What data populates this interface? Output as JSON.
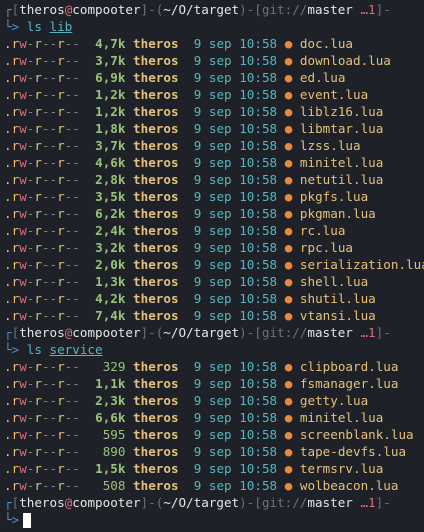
{
  "prompt": {
    "user": "theros",
    "at": "@",
    "host": "compooter",
    "path": "~/O/target",
    "git_prefix": "git://",
    "branch": "master",
    "status": "…1"
  },
  "commands": [
    {
      "cmd": "ls",
      "arg": "lib"
    },
    {
      "cmd": "ls",
      "arg": "service"
    }
  ],
  "listings": [
    {
      "entries": [
        {
          "perm": ".rw-r--r--",
          "size": "4,7k",
          "owner": "theros",
          "date": "9 sep 10:58",
          "icon": "lua-icon",
          "name": "doc.lua"
        },
        {
          "perm": ".rw-r--r--",
          "size": "3,7k",
          "owner": "theros",
          "date": "9 sep 10:58",
          "icon": "lua-icon",
          "name": "download.lua"
        },
        {
          "perm": ".rw-r--r--",
          "size": "6,9k",
          "owner": "theros",
          "date": "9 sep 10:58",
          "icon": "lua-icon",
          "name": "ed.lua"
        },
        {
          "perm": ".rw-r--r--",
          "size": "1,2k",
          "owner": "theros",
          "date": "9 sep 10:58",
          "icon": "lua-icon",
          "name": "event.lua"
        },
        {
          "perm": ".rw-r--r--",
          "size": "1,2k",
          "owner": "theros",
          "date": "9 sep 10:58",
          "icon": "lua-icon",
          "name": "liblz16.lua"
        },
        {
          "perm": ".rw-r--r--",
          "size": "1,8k",
          "owner": "theros",
          "date": "9 sep 10:58",
          "icon": "lua-icon",
          "name": "libmtar.lua"
        },
        {
          "perm": ".rw-r--r--",
          "size": "3,7k",
          "owner": "theros",
          "date": "9 sep 10:58",
          "icon": "lua-icon",
          "name": "lzss.lua"
        },
        {
          "perm": ".rw-r--r--",
          "size": "4,6k",
          "owner": "theros",
          "date": "9 sep 10:58",
          "icon": "lua-icon",
          "name": "minitel.lua"
        },
        {
          "perm": ".rw-r--r--",
          "size": "2,8k",
          "owner": "theros",
          "date": "9 sep 10:58",
          "icon": "lua-icon",
          "name": "netutil.lua"
        },
        {
          "perm": ".rw-r--r--",
          "size": "3,5k",
          "owner": "theros",
          "date": "9 sep 10:58",
          "icon": "lua-icon",
          "name": "pkgfs.lua"
        },
        {
          "perm": ".rw-r--r--",
          "size": "6,2k",
          "owner": "theros",
          "date": "9 sep 10:58",
          "icon": "lua-icon",
          "name": "pkgman.lua"
        },
        {
          "perm": ".rw-r--r--",
          "size": "2,4k",
          "owner": "theros",
          "date": "9 sep 10:58",
          "icon": "lua-icon",
          "name": "rc.lua"
        },
        {
          "perm": ".rw-r--r--",
          "size": "3,2k",
          "owner": "theros",
          "date": "9 sep 10:58",
          "icon": "lua-icon",
          "name": "rpc.lua"
        },
        {
          "perm": ".rw-r--r--",
          "size": "2,0k",
          "owner": "theros",
          "date": "9 sep 10:58",
          "icon": "lua-icon",
          "name": "serialization.lua"
        },
        {
          "perm": ".rw-r--r--",
          "size": "1,3k",
          "owner": "theros",
          "date": "9 sep 10:58",
          "icon": "lua-icon",
          "name": "shell.lua"
        },
        {
          "perm": ".rw-r--r--",
          "size": "4,2k",
          "owner": "theros",
          "date": "9 sep 10:58",
          "icon": "lua-icon",
          "name": "shutil.lua"
        },
        {
          "perm": ".rw-r--r--",
          "size": "7,4k",
          "owner": "theros",
          "date": "9 sep 10:58",
          "icon": "lua-icon",
          "name": "vtansi.lua"
        }
      ]
    },
    {
      "entries": [
        {
          "perm": ".rw-r--r--",
          "size": "329",
          "owner": "theros",
          "date": "9 sep 10:58",
          "icon": "lua-icon",
          "name": "clipboard.lua"
        },
        {
          "perm": ".rw-r--r--",
          "size": "1,1k",
          "owner": "theros",
          "date": "9 sep 10:58",
          "icon": "lua-icon",
          "name": "fsmanager.lua"
        },
        {
          "perm": ".rw-r--r--",
          "size": "2,3k",
          "owner": "theros",
          "date": "9 sep 10:58",
          "icon": "lua-icon",
          "name": "getty.lua"
        },
        {
          "perm": ".rw-r--r--",
          "size": "6,6k",
          "owner": "theros",
          "date": "9 sep 10:58",
          "icon": "lua-icon",
          "name": "minitel.lua"
        },
        {
          "perm": ".rw-r--r--",
          "size": "595",
          "owner": "theros",
          "date": "9 sep 10:58",
          "icon": "lua-icon",
          "name": "screenblank.lua"
        },
        {
          "perm": ".rw-r--r--",
          "size": "890",
          "owner": "theros",
          "date": "9 sep 10:58",
          "icon": "lua-icon",
          "name": "tape-devfs.lua"
        },
        {
          "perm": ".rw-r--r--",
          "size": "1,5k",
          "owner": "theros",
          "date": "9 sep 10:58",
          "icon": "lua-icon",
          "name": "termsrv.lua"
        },
        {
          "perm": ".rw-r--r--",
          "size": "508",
          "owner": "theros",
          "date": "9 sep 10:58",
          "icon": "lua-icon",
          "name": "wolbeacon.lua"
        }
      ]
    }
  ],
  "icon_glyph": "●",
  "colors": {
    "background": "#1e2127",
    "accent_yellow": "#e5c07b",
    "accent_red": "#e06c75",
    "accent_cyan": "#56b6c2",
    "accent_green": "#98c379",
    "lua_icon": "#e8893b"
  }
}
